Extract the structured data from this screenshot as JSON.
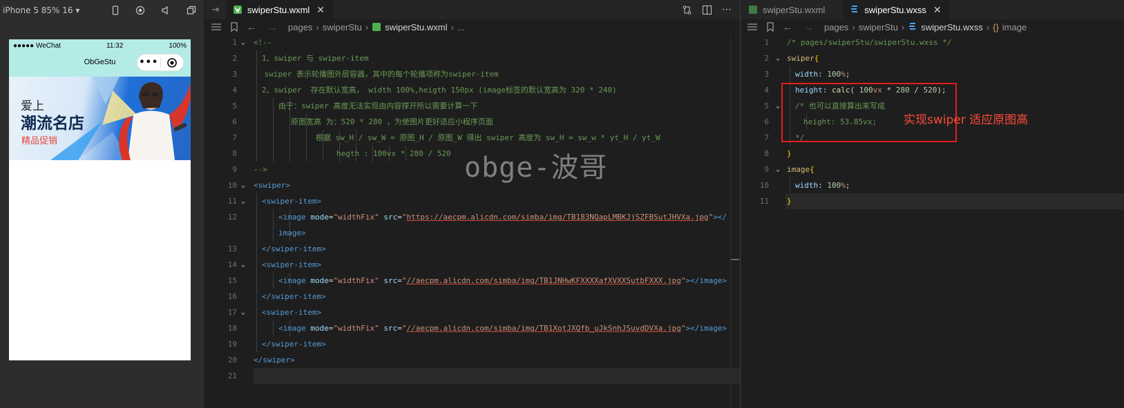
{
  "simulator": {
    "device_label": "iPhone 5 85% 16 ▾",
    "status": {
      "signal": "●●●●● WeChat",
      "time": "11:32",
      "battery": "100%"
    },
    "nav_title": "ObGeStu",
    "capsule_more": "•••",
    "banner": {
      "line1": "爱上",
      "line2": "潮流名店",
      "line3": "精品促销"
    }
  },
  "wxml": {
    "tab_label": "swiperStu.wxml",
    "tab_close": "✕",
    "breadcrumb": [
      "pages",
      "swiperStu",
      "swiperStu.wxml",
      "..."
    ],
    "lines": [
      {
        "n": "1",
        "indent": 0,
        "fold": "⌄",
        "tokens": [
          [
            "cm",
            "<!--"
          ]
        ]
      },
      {
        "n": "2",
        "indent": 1,
        "fold": "",
        "tokens": [
          [
            "cm",
            "1、swiper 与 swiper-item"
          ]
        ]
      },
      {
        "n": "3",
        "indent": 1.3,
        "fold": "",
        "tokens": [
          [
            "cm",
            "swiper 表示轮播图外层容器，其中的每个轮播项称为swiper-item"
          ]
        ]
      },
      {
        "n": "4",
        "indent": 1,
        "fold": "",
        "tokens": [
          [
            "cm",
            "2、swiper  存在默认宽高， width 100%,heigth 150px (image标签的默认宽高为 320 * 240)"
          ]
        ]
      },
      {
        "n": "5",
        "indent": 3,
        "fold": "",
        "tokens": [
          [
            "cm",
            "由于：swiper 高度无法实现由内容撑开所以需要计算一下"
          ]
        ]
      },
      {
        "n": "6",
        "indent": 4.5,
        "fold": "",
        "tokens": [
          [
            "cm",
            "原图宽高 为：520 * 280 ，为使图片更好适应小程序页面"
          ]
        ]
      },
      {
        "n": "7",
        "indent": 7.5,
        "fold": "",
        "tokens": [
          [
            "cm",
            "根据 sw_H / sw_W = 原图_H / 原图_W 得出 swiper 高度为 sw_H = sw_w * yt_H / yt_W"
          ]
        ]
      },
      {
        "n": "8",
        "indent": 10,
        "fold": "",
        "tokens": [
          [
            "cm",
            "hegth : 100vx * 280 / 520"
          ]
        ]
      },
      {
        "n": "9",
        "indent": 0,
        "fold": "",
        "tokens": [
          [
            "cm",
            "-->"
          ]
        ]
      },
      {
        "n": "10",
        "indent": 0,
        "fold": "⌄",
        "tokens": [
          [
            "tag",
            "<swiper>"
          ]
        ]
      },
      {
        "n": "11",
        "indent": 1,
        "fold": "⌄",
        "tokens": [
          [
            "tag",
            "<swiper-item>"
          ]
        ]
      },
      {
        "n": "12",
        "indent": 3,
        "fold": "",
        "tokens": [
          [
            "tag",
            "<image "
          ],
          [
            "attr",
            "mode"
          ],
          [
            "plain",
            "="
          ],
          [
            "str",
            "\"widthFix\""
          ],
          [
            "plain",
            " "
          ],
          [
            "attr",
            "src"
          ],
          [
            "plain",
            "="
          ],
          [
            "str",
            "\""
          ],
          [
            "url",
            "https://aecpm.alicdn.com/simba/img/TB183NQapLMBKJjSZFBSutJHVXa.jpg"
          ],
          [
            "str",
            "\""
          ],
          [
            "tag",
            "></"
          ]
        ]
      },
      {
        "n": "",
        "indent": 3,
        "fold": "",
        "tokens": [
          [
            "tag",
            "image>"
          ]
        ]
      },
      {
        "n": "13",
        "indent": 1,
        "fold": "",
        "tokens": [
          [
            "tag",
            "</swiper-item>"
          ]
        ]
      },
      {
        "n": "14",
        "indent": 1,
        "fold": "⌄",
        "tokens": [
          [
            "tag",
            "<swiper-item>"
          ]
        ]
      },
      {
        "n": "15",
        "indent": 3,
        "fold": "",
        "tokens": [
          [
            "tag",
            "<image "
          ],
          [
            "attr",
            "mode"
          ],
          [
            "plain",
            "="
          ],
          [
            "str",
            "\"widthFix\""
          ],
          [
            "plain",
            " "
          ],
          [
            "attr",
            "src"
          ],
          [
            "plain",
            "="
          ],
          [
            "str",
            "\""
          ],
          [
            "url",
            "//aecpm.alicdn.com/simba/img/TB1JNHwKFXXXXafXVXXSutbFXXX.jpg"
          ],
          [
            "str",
            "\""
          ],
          [
            "tag",
            "></image>"
          ]
        ]
      },
      {
        "n": "16",
        "indent": 1,
        "fold": "",
        "tokens": [
          [
            "tag",
            "</swiper-item>"
          ]
        ]
      },
      {
        "n": "17",
        "indent": 1,
        "fold": "⌄",
        "tokens": [
          [
            "tag",
            "<swiper-item>"
          ]
        ]
      },
      {
        "n": "18",
        "indent": 3,
        "fold": "",
        "tokens": [
          [
            "tag",
            "<image "
          ],
          [
            "attr",
            "mode"
          ],
          [
            "plain",
            "="
          ],
          [
            "str",
            "\"widthFix\""
          ],
          [
            "plain",
            " "
          ],
          [
            "attr",
            "src"
          ],
          [
            "plain",
            "="
          ],
          [
            "str",
            "\""
          ],
          [
            "url",
            "//aecpm.alicdn.com/simba/img/TB1XotJXQfb_uJkSnhJSuvdDVXa.jpg"
          ],
          [
            "str",
            "\""
          ],
          [
            "tag",
            "></image>"
          ]
        ]
      },
      {
        "n": "19",
        "indent": 1,
        "fold": "",
        "tokens": [
          [
            "tag",
            "</swiper-item>"
          ]
        ]
      },
      {
        "n": "20",
        "indent": 0,
        "fold": "",
        "tokens": [
          [
            "tag",
            "</swiper>"
          ]
        ]
      },
      {
        "n": "21",
        "indent": 0,
        "fold": "",
        "tokens": [],
        "current": true
      }
    ]
  },
  "wxss": {
    "tab_inactive_label": "swiperStu.wxml",
    "tab_label": "swiperStu.wxss",
    "tab_close": "✕",
    "breadcrumb": [
      "pages",
      "swiperStu",
      "swiperStu.wxss",
      "image"
    ],
    "lines": [
      {
        "n": "1",
        "indent": 0,
        "fold": "",
        "tokens": [
          [
            "cm",
            "/* pages/swiperStu/swiperStu.wxss */"
          ]
        ]
      },
      {
        "n": "2",
        "indent": 0,
        "fold": "⌄",
        "tokens": [
          [
            "sel",
            "swiper"
          ],
          [
            "br",
            "{"
          ]
        ]
      },
      {
        "n": "3",
        "indent": 1,
        "fold": "",
        "tokens": [
          [
            "prop",
            "width"
          ],
          [
            "plain",
            ": "
          ],
          [
            "num",
            "100"
          ],
          [
            "kw",
            "%"
          ],
          [
            "plain",
            ";"
          ]
        ]
      },
      {
        "n": "4",
        "indent": 1,
        "fold": "",
        "tokens": [
          [
            "prop",
            "height"
          ],
          [
            "plain",
            ": "
          ],
          [
            "fn",
            "calc"
          ],
          [
            "plain",
            "( "
          ],
          [
            "num",
            "100"
          ],
          [
            "kw",
            "vx"
          ],
          [
            "plain",
            " * "
          ],
          [
            "num",
            "280"
          ],
          [
            "plain",
            " / "
          ],
          [
            "num",
            "520"
          ],
          [
            "plain",
            ");"
          ]
        ]
      },
      {
        "n": "5",
        "indent": 1,
        "fold": "⌄",
        "tokens": [
          [
            "cm",
            "/* 也可以直接算出来写成"
          ]
        ]
      },
      {
        "n": "6",
        "indent": 2,
        "fold": "",
        "tokens": [
          [
            "cm",
            "height: 53.85vx;"
          ]
        ]
      },
      {
        "n": "7",
        "indent": 1,
        "fold": "",
        "tokens": [
          [
            "cm",
            "*/"
          ]
        ]
      },
      {
        "n": "8",
        "indent": 0,
        "fold": "",
        "tokens": [
          [
            "br",
            "}"
          ]
        ]
      },
      {
        "n": "9",
        "indent": 0,
        "fold": "⌄",
        "tokens": [
          [
            "sel",
            "image"
          ],
          [
            "br",
            "{"
          ]
        ]
      },
      {
        "n": "10",
        "indent": 1,
        "fold": "",
        "tokens": [
          [
            "prop",
            "width"
          ],
          [
            "plain",
            ": "
          ],
          [
            "num",
            "100"
          ],
          [
            "kw",
            "%"
          ],
          [
            "plain",
            ";"
          ]
        ]
      },
      {
        "n": "11",
        "indent": 0,
        "fold": "",
        "tokens": [
          [
            "br",
            "}"
          ]
        ],
        "current": true
      }
    ]
  },
  "watermark": "obge-波哥",
  "annotation": "实现swiper 适应原图高",
  "colors": {
    "accent_red": "#e0201a",
    "editor_bg": "#1e1e1e",
    "nav_bg": "#b5ebe6"
  }
}
